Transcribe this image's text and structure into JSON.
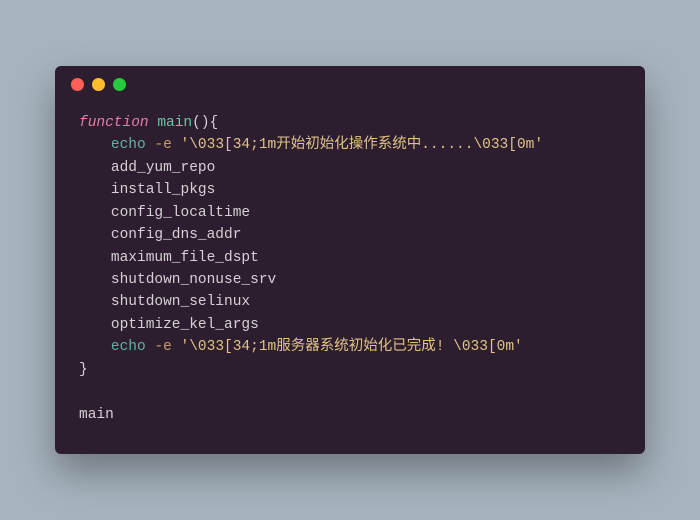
{
  "colors": {
    "background": "#a7b4bf",
    "terminal_bg": "#2c1e2e",
    "dot_red": "#ff5f56",
    "dot_yellow": "#ffbd2e",
    "dot_green": "#27c93f",
    "keyword": "#e87da4",
    "function_name": "#66c6a6",
    "command": "#5fb3a1",
    "flag": "#c89c6e",
    "string": "#e0c285",
    "text": "#d6d0d6"
  },
  "code": {
    "line1": {
      "keyword": "function",
      "name": " main",
      "tail": "(){"
    },
    "line2": {
      "cmd": "echo",
      "flag": " -e ",
      "str": "'\\033[34;1m开始初始化操作系统中......\\033[0m'"
    },
    "line3": "add_yum_repo",
    "line4": "install_pkgs",
    "line5": "config_localtime",
    "line6": "config_dns_addr",
    "line7": "maximum_file_dspt",
    "line8": "shutdown_nonuse_srv",
    "line9": "shutdown_selinux",
    "line10": "optimize_kel_args",
    "line11": {
      "cmd": "echo",
      "flag": " -e ",
      "str": "'\\033[34;1m服务器系统初始化已完成! \\033[0m'"
    },
    "line12": "}",
    "line13": "",
    "line14": "main"
  }
}
